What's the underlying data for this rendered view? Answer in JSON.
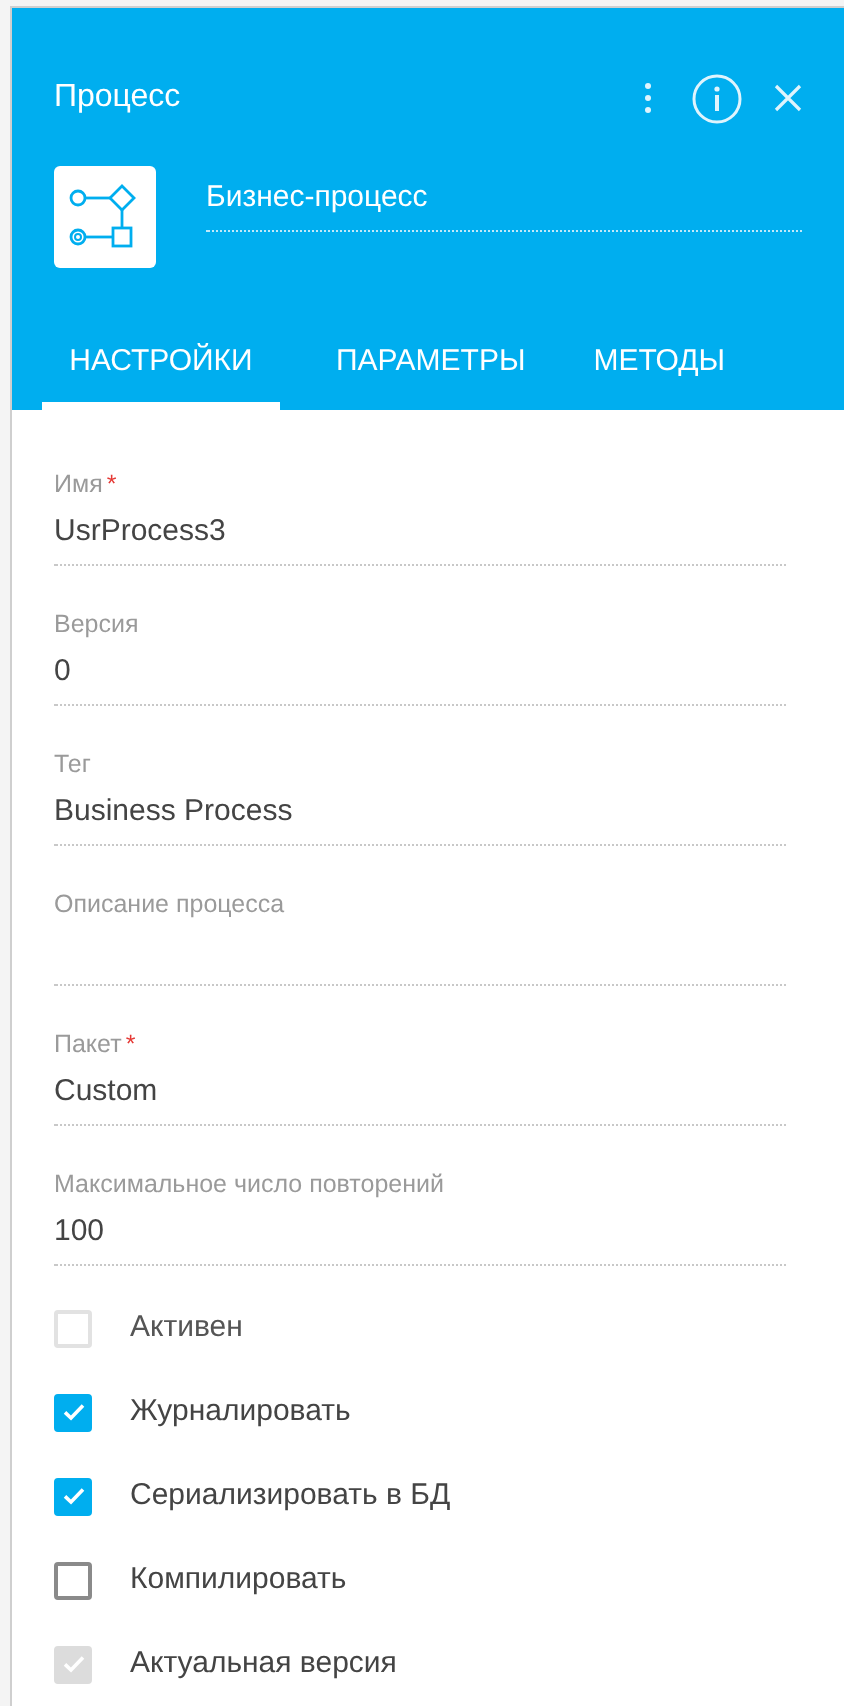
{
  "header": {
    "title": "Процесс",
    "name": "Бизнес-процесс"
  },
  "tabs": [
    {
      "label": "НАСТРОЙКИ",
      "selected": true
    },
    {
      "label": "ПАРАМЕТРЫ",
      "selected": false
    },
    {
      "label": "МЕТОДЫ",
      "selected": false
    }
  ],
  "fields": [
    {
      "label": "Имя",
      "required_mark": "*",
      "value": "UsrProcess3"
    },
    {
      "label": "Версия",
      "value": "0"
    },
    {
      "label": "Тег",
      "value": "Business Process"
    },
    {
      "label": "Описание процесса"
    },
    {
      "label": "Пакет",
      "required_mark": "*",
      "value": "Custom"
    },
    {
      "label": "Максимальное число повторений",
      "value": "100"
    }
  ],
  "checkboxes": [
    {
      "label": "Активен",
      "checked": false,
      "disabled": true
    },
    {
      "label": "Журналировать",
      "checked": true,
      "disabled": false
    },
    {
      "label": "Сериализировать в БД",
      "checked": true,
      "disabled": false
    },
    {
      "label": "Компилировать",
      "checked": false,
      "disabled": false
    },
    {
      "label": "Актуальная версия",
      "checked": true,
      "disabled": true
    }
  ]
}
